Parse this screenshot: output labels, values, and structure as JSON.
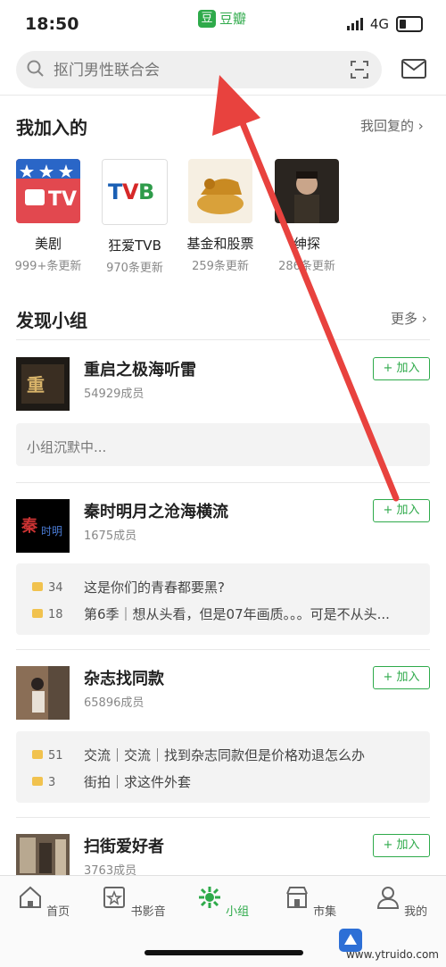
{
  "status": {
    "time": "18:50",
    "app_name": "豆瓣",
    "app_logo_char": "豆",
    "network": "4G"
  },
  "search": {
    "placeholder": "抠门男性联合会"
  },
  "joined": {
    "title": "我加入的",
    "replied_link": "我回复的",
    "items": [
      {
        "name": "美剧",
        "updates": "999+条更新"
      },
      {
        "name": "狂爱TVB",
        "updates": "970条更新"
      },
      {
        "name": "基金和股票",
        "updates": "259条更新"
      },
      {
        "name": "绅探",
        "updates": "286条更新"
      }
    ]
  },
  "discover": {
    "title": "发现小组",
    "more_link": "更多",
    "groups": [
      {
        "name": "重启之极海听雷",
        "members": "54929成员",
        "join_label": "+ 加入",
        "quiet": "小组沉默中...",
        "posts": []
      },
      {
        "name": "秦时明月之沧海横流",
        "members": "1675成员",
        "join_label": "+ 加入",
        "posts": [
          {
            "count": "34",
            "text": "这是你们的青春都要黑?"
          },
          {
            "count": "18",
            "text": "第6季｜想从头看，但是07年画质。。。可是不从头..."
          }
        ]
      },
      {
        "name": "杂志找同款",
        "members": "65896成员",
        "join_label": "+ 加入",
        "posts": [
          {
            "count": "51",
            "text": "交流｜交流｜找到杂志同款但是价格劝退怎么办"
          },
          {
            "count": "3",
            "text": "街拍｜求这件外套"
          }
        ]
      },
      {
        "name": "扫街爱好者",
        "members": "3763成员",
        "join_label": "+ 加入",
        "posts": []
      }
    ]
  },
  "tabbar": {
    "tabs": [
      {
        "label": "首页"
      },
      {
        "label": "书影音"
      },
      {
        "label": "小组"
      },
      {
        "label": "市集"
      },
      {
        "label": "我的"
      }
    ]
  },
  "watermark": {
    "text": "www.ytruido.com"
  },
  "colors": {
    "accent": "#2eaa4a",
    "arrow": "#e8423e"
  }
}
